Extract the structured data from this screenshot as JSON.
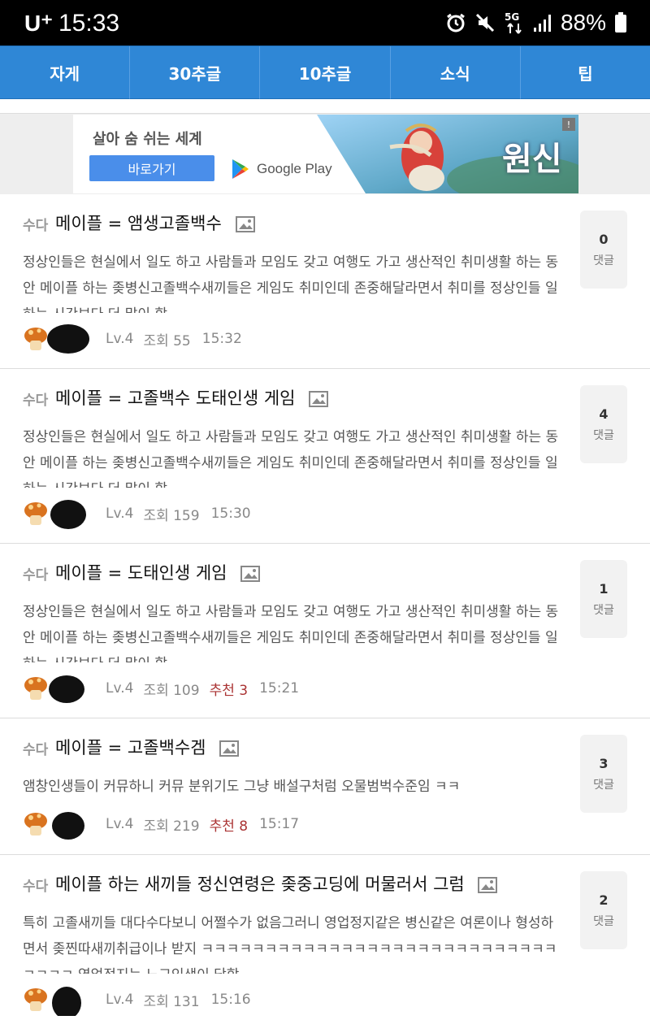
{
  "status_bar": {
    "carrier": "U⁺",
    "time": "15:33",
    "network": "5G",
    "battery_percent": "88%",
    "icons": [
      "alarm-icon",
      "mute-icon",
      "5g-icon",
      "signal-icon",
      "battery-icon"
    ]
  },
  "tabs": [
    {
      "label": "자게"
    },
    {
      "label": "30추글"
    },
    {
      "label": "10추글"
    },
    {
      "label": "소식"
    },
    {
      "label": "팁"
    }
  ],
  "ad": {
    "title": "살아 숨 쉬는 세계",
    "button": "바로가기",
    "store": "Google Play",
    "game_logo": "원신"
  },
  "posts": [
    {
      "category": "수다",
      "title": "메이플 = 앰생고졸백수",
      "excerpt": "정상인들은 현실에서 일도 하고 사람들과 모임도 갖고 여행도 가고 생산적인 취미생활 하는 동안 메이플 하는 좆병신고졸백수새끼들은 게임도 취미인데 존중해달라면서 취미를 정상인들 일하는 시간보다 더 많이 함",
      "level": "Lv.4",
      "views": "조회 55",
      "recommend": "",
      "time": "15:32",
      "comments": "0",
      "comments_label": "댓글"
    },
    {
      "category": "수다",
      "title": "메이플 = 고졸백수 도태인생 게임",
      "excerpt": "정상인들은 현실에서 일도 하고 사람들과 모임도 갖고 여행도 가고 생산적인 취미생활 하는 동안 메이플 하는 좆병신고졸백수새끼들은 게임도 취미인데 존중해달라면서 취미를 정상인들 일하는 시간보다 더 많이 함",
      "level": "Lv.4",
      "views": "조회 159",
      "recommend": "",
      "time": "15:30",
      "comments": "4",
      "comments_label": "댓글"
    },
    {
      "category": "수다",
      "title": "메이플 = 도태인생 게임",
      "excerpt": "정상인들은 현실에서 일도 하고 사람들과 모임도 갖고 여행도 가고 생산적인 취미생활 하는 동안 메이플 하는 좆병신고졸백수새끼들은 게임도 취미인데 존중해달라면서 취미를 정상인들 일하는 시간보다 더 많이 함",
      "level": "Lv.4",
      "views": "조회 109",
      "recommend": "추천 3",
      "time": "15:21",
      "comments": "1",
      "comments_label": "댓글"
    },
    {
      "category": "수다",
      "title": "메이플 = 고졸백수겜",
      "excerpt": "앰창인생들이 커뮤하니 커뮤 분위기도 그냥 배설구처럼 오물범벅수준임 ㅋㅋ",
      "level": "Lv.4",
      "views": "조회 219",
      "recommend": "추천 8",
      "time": "15:17",
      "comments": "3",
      "comments_label": "댓글"
    },
    {
      "category": "수다",
      "title": "메이플 하는 새끼들 정신연령은 좆중고딩에 머물러서 그럼",
      "excerpt": "특히 고졸새끼들 대다수다보니 어쩔수가 없음그러니 영업정지같은 병신같은 여론이나 형성하면서 좆찐따새끼취급이나 받지 ㅋㅋㅋㅋㅋㅋㅋㅋㅋㅋㅋㅋㅋㅋㅋㅋㅋㅋㅋㅋㅋㅋㅋㅋㅋㅋㅋㅋㅋㅋㅋㅋ 영업정지는 노그인생이 당함",
      "level": "Lv.4",
      "views": "조회 131",
      "recommend": "",
      "time": "15:16",
      "comments": "2",
      "comments_label": "댓글"
    }
  ],
  "colors": {
    "tab_bar": "#2f87d6",
    "ad_button": "#4a8eea",
    "recommend": "#a33333"
  }
}
